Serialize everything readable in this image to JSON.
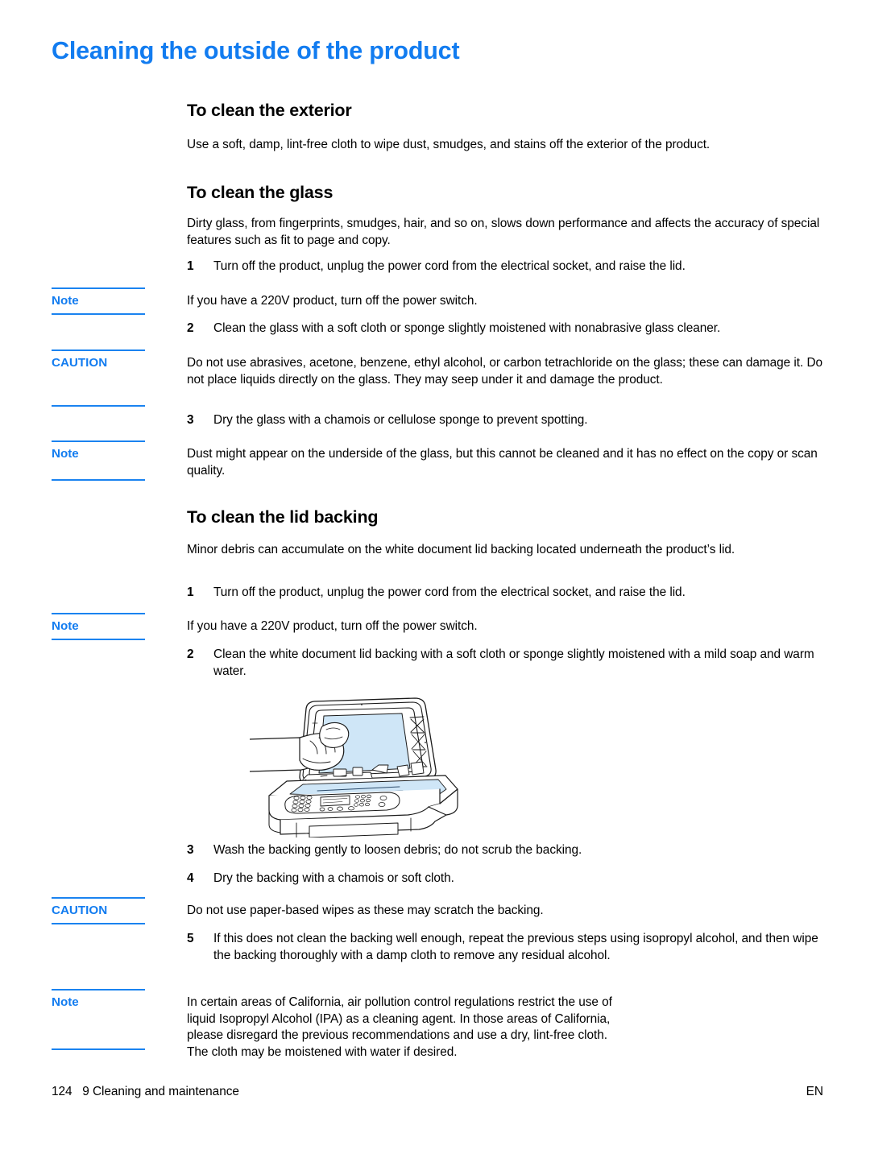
{
  "document": {
    "title": "Cleaning the outside of the product",
    "accent_color": "#127cf0",
    "text_color": "#000000",
    "page_background": "#ffffff"
  },
  "sections": {
    "exterior": {
      "heading": "To clean the exterior",
      "paragraph": "Use a soft, damp, lint-free cloth to wipe dust, smudges, and stains off the exterior of the product."
    },
    "glass": {
      "heading": "To clean the glass",
      "intro": "Dirty glass, from fingerprints, smudges, hair, and so on, slows down performance and affects the accuracy of special features such as fit to page and copy.",
      "step1_num": "1",
      "step1_text": "Turn off the product, unplug the power cord from the electrical socket, and raise the lid.",
      "note1_label": "Note",
      "note1_text": "If you have a 220V product, turn off the power switch.",
      "step2_num": "2",
      "step2_text": "Clean the glass with a soft cloth or sponge slightly moistened with nonabrasive glass cleaner.",
      "caution1_label": "CAUTION",
      "caution1_text": "Do not use abrasives, acetone, benzene, ethyl alcohol, or carbon tetrachloride on the glass; these can damage it. Do not place liquids directly on the glass. They may seep under it and damage the product.",
      "step3_num": "3",
      "step3_text": "Dry the glass with a chamois or cellulose sponge to prevent spotting.",
      "note2_label": "Note",
      "note2_text": "Dust might appear on the underside of the glass, but this cannot be cleaned and it has no effect on the copy or scan quality."
    },
    "lid_backing": {
      "heading": "To clean the lid backing",
      "intro": "Minor debris can accumulate on the white document lid backing located underneath the product’s lid.",
      "step1_num": "1",
      "step1_text": "Turn off the product, unplug the power cord from the electrical socket, and raise the lid.",
      "note1_label": "Note",
      "note1_text": "If you have a 220V product, turn off the power switch.",
      "step2_num": "2",
      "step2_text": "Clean the white document lid backing with a soft cloth or sponge slightly moistened with a mild soap and warm water.",
      "step3_num": "3",
      "step3_text": "Wash the backing gently to loosen debris; do not scrub the backing.",
      "step4_num": "4",
      "step4_text": "Dry the backing with a chamois or soft cloth.",
      "caution1_label": "CAUTION",
      "caution1_text": "Do not use paper-based wipes as these may scratch the backing.",
      "step5_num": "5",
      "step5_text": "If this does not clean the backing well enough, repeat the previous steps using isopropyl alcohol, and then wipe the backing thoroughly with a damp cloth to remove any residual alcohol.",
      "note2_label": "Note",
      "note2_line1": "In certain areas of California, air pollution control regulations restrict the use of",
      "note2_line2": "liquid Isopropyl Alcohol (IPA) as a cleaning agent.  In those areas of California,",
      "note2_line3": "please disregard the previous recommendations and use a dry, lint-free cloth.",
      "note2_line4": "The cloth may be moistened with water if desired."
    }
  },
  "illustration": {
    "name": "all-in-one-printer-cleaning-lid-backing-illustration",
    "description": "Line drawing of an all-in-one printer with the scanner lid raised and a hand using a cloth to wipe the white document lid backing",
    "glass_fill": "#cfe6f7",
    "line_color": "#1a1a1a"
  },
  "footer": {
    "page_number": "124",
    "chapter": "9 Cleaning and maintenance",
    "left_combined": "124   9 Cleaning and maintenance",
    "language": "EN"
  }
}
